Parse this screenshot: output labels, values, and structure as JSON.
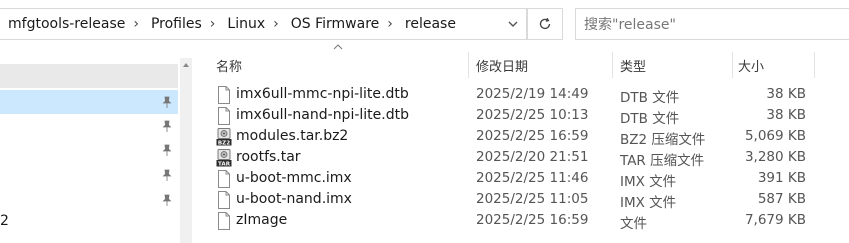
{
  "address_bar": {
    "crumbs": [
      "mfgtools-release",
      "Profiles",
      "Linux",
      "OS Firmware",
      "release"
    ]
  },
  "search": {
    "placeholder": "搜索\"release\""
  },
  "nav": {
    "partial_label": "2"
  },
  "columns": {
    "name": "名称",
    "date": "修改日期",
    "type": "类型",
    "size": "大小"
  },
  "files": [
    {
      "name": "imx6ull-mmc-npi-lite.dtb",
      "date": "2025/2/19 14:49",
      "type": "DTB 文件",
      "size": "38 KB",
      "icon": "file-icon"
    },
    {
      "name": "imx6ull-nand-npi-lite.dtb",
      "date": "2025/2/25 10:13",
      "type": "DTB 文件",
      "size": "38 KB",
      "icon": "file-icon"
    },
    {
      "name": "modules.tar.bz2",
      "date": "2025/2/25 16:59",
      "type": "BZ2 压缩文件",
      "size": "5,069 KB",
      "icon": "bz2-archive-icon"
    },
    {
      "name": "rootfs.tar",
      "date": "2025/2/20 21:51",
      "type": "TAR 压缩文件",
      "size": "3,280 KB",
      "icon": "tar-archive-icon"
    },
    {
      "name": "u-boot-mmc.imx",
      "date": "2025/2/25 11:46",
      "type": "IMX 文件",
      "size": "391 KB",
      "icon": "file-icon"
    },
    {
      "name": "u-boot-nand.imx",
      "date": "2025/2/25 11:05",
      "type": "IMX 文件",
      "size": "587 KB",
      "icon": "file-icon"
    },
    {
      "name": "zImage",
      "date": "2025/2/25 16:59",
      "type": "文件",
      "size": "7,679 KB",
      "icon": "file-icon"
    }
  ]
}
